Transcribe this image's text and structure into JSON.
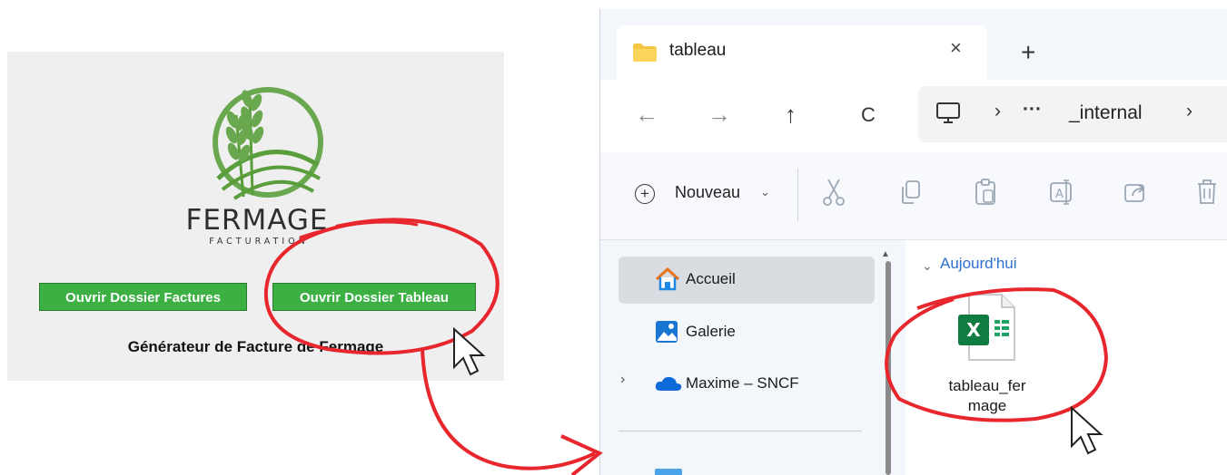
{
  "app": {
    "brand": "FERMAGE",
    "brand_sub": "FACTURATION",
    "btn_factures": "Ouvrir Dossier Factures",
    "btn_tableau": "Ouvrir Dossier Tableau",
    "footer": "Générateur de Facture de Fermage"
  },
  "explorer": {
    "tab_title": "tableau",
    "tab_close": "×",
    "new_tab": "+",
    "nav": {
      "back": "←",
      "forward": "→",
      "up": "↑",
      "refresh": "C"
    },
    "address": {
      "sep": "›",
      "dots": "···",
      "segment": "_internal"
    },
    "toolbar": {
      "new_label": "Nouveau",
      "new_chevron": "⌄"
    },
    "sidebar": {
      "items": [
        {
          "label": "Accueil",
          "icon": "home-icon"
        },
        {
          "label": "Galerie",
          "icon": "gallery-icon"
        },
        {
          "label": "Maxime – SNCF",
          "icon": "onedrive-cloud-icon"
        }
      ],
      "expand_chevron": "›"
    },
    "content": {
      "group_label": "Aujourd'hui",
      "group_chevron": "⌄",
      "file_name_line1": "tableau_fer",
      "file_name_line2": "mage",
      "file_icon": "excel-file-icon",
      "file_icon_letter": "X"
    }
  },
  "colors": {
    "button_green": "#3cb043",
    "annotation_red": "#e8262d",
    "link_blue": "#2e6fd0"
  }
}
